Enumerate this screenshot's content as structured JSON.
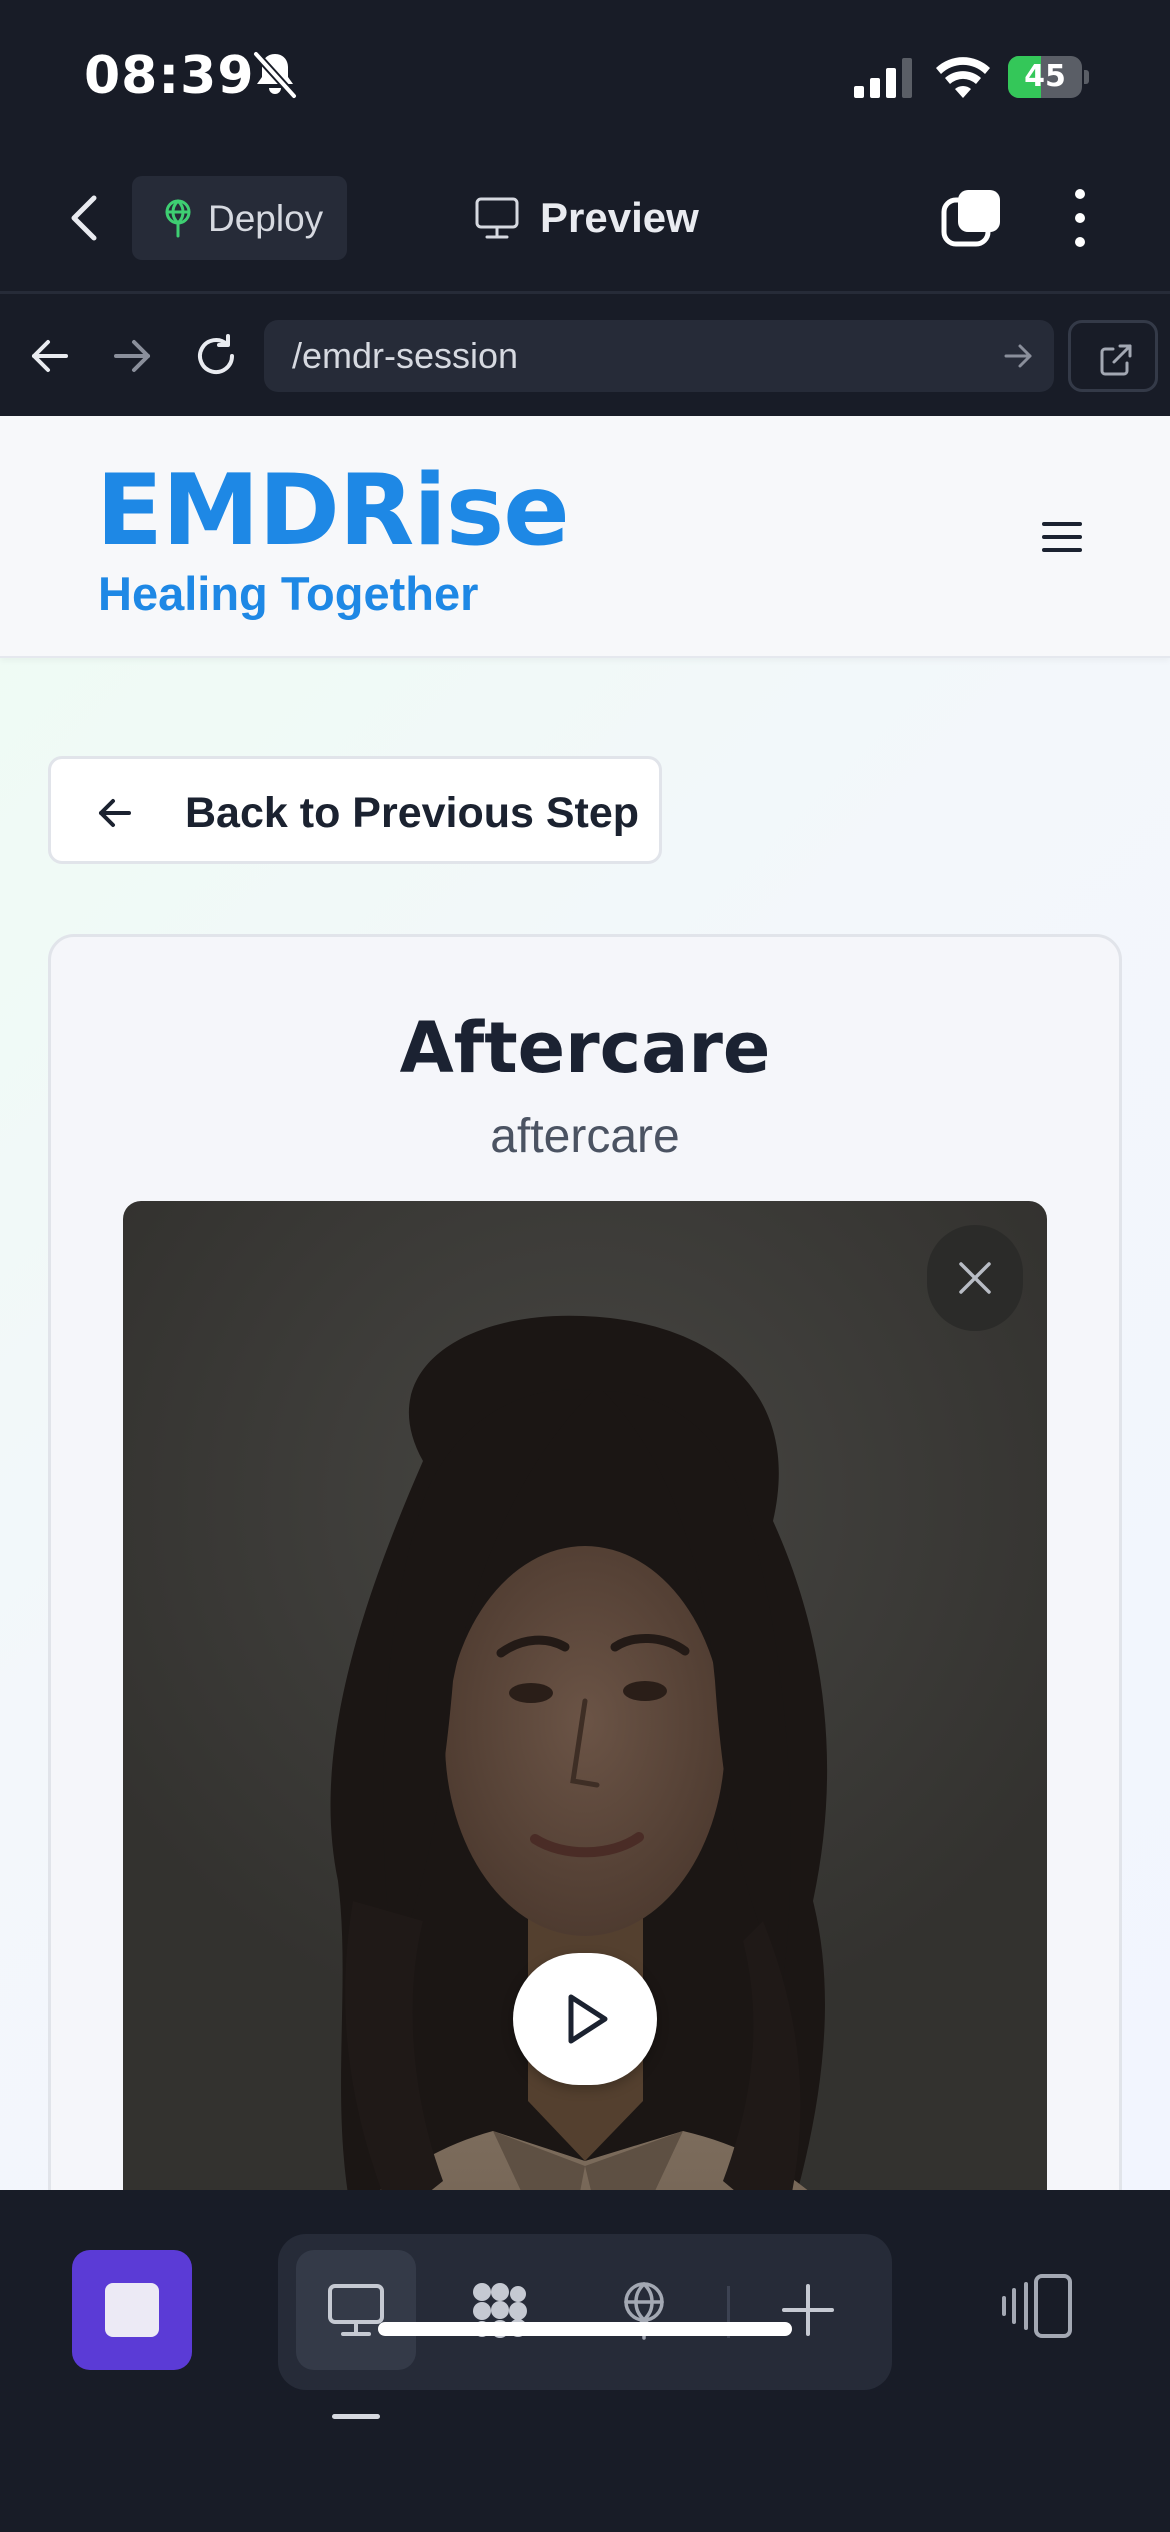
{
  "status_bar": {
    "time": "08:39",
    "battery_level": "45",
    "battery_fraction": 0.45,
    "icons": [
      "bell-slash-icon",
      "cellular-signal-icon",
      "wifi-icon",
      "battery-charging-icon"
    ]
  },
  "top_bar": {
    "deploy_label": "Deploy",
    "preview_label": "Preview",
    "icons": [
      "chevron-left-icon",
      "deploy-icon",
      "monitor-icon",
      "tabs-icon",
      "more-vertical-icon"
    ]
  },
  "url_bar": {
    "url": "/emdr-session",
    "icons": [
      "arrow-left-icon",
      "arrow-right-icon",
      "reload-icon",
      "go-arrow-icon",
      "external-link-icon"
    ]
  },
  "site": {
    "brand": "EMDRise",
    "tagline": "Healing Together",
    "back_button": "Back to Previous Step",
    "card": {
      "title": "Aftercare",
      "subtitle": "aftercare"
    }
  },
  "toolbar": {
    "icons": [
      "stop-icon",
      "monitor-icon",
      "apps-grid-icon",
      "deploy-icon",
      "plus-icon",
      "device-panel-icon"
    ],
    "active_item": "monitor-icon"
  },
  "colors": {
    "brand_blue": "#1e88e5",
    "accent_purple": "#5b3bd6",
    "battery_green": "#34c759",
    "chrome_dark": "#181c27"
  }
}
